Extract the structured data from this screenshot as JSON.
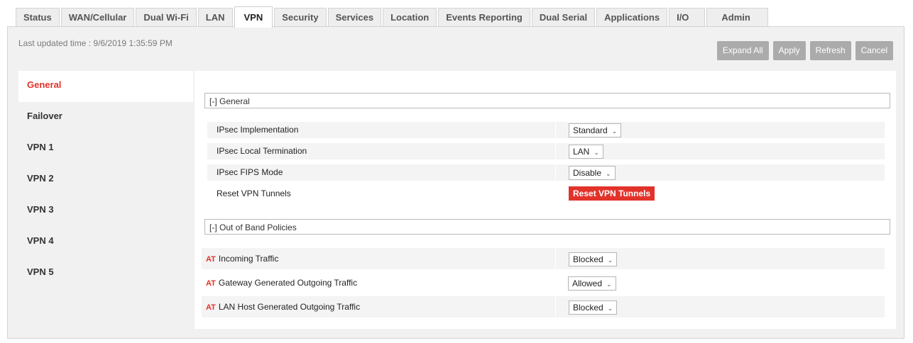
{
  "tabs": [
    {
      "label": "Status",
      "active": false
    },
    {
      "label": "WAN/Cellular",
      "active": false
    },
    {
      "label": "Dual Wi-Fi",
      "active": false
    },
    {
      "label": "LAN",
      "active": false
    },
    {
      "label": "VPN",
      "active": true
    },
    {
      "label": "Security",
      "active": false
    },
    {
      "label": "Services",
      "active": false
    },
    {
      "label": "Location",
      "active": false
    },
    {
      "label": "Events Reporting",
      "active": false
    },
    {
      "label": "Dual Serial",
      "active": false
    },
    {
      "label": "Applications",
      "active": false
    },
    {
      "label": "I/O",
      "active": false
    },
    {
      "label": "Admin",
      "active": false
    }
  ],
  "last_updated": "Last updated time : 9/6/2019 1:35:59 PM",
  "toolbar": {
    "expand_all": "Expand All",
    "apply": "Apply",
    "refresh": "Refresh",
    "cancel": "Cancel"
  },
  "sidebar": {
    "items": [
      {
        "label": "General",
        "active": true
      },
      {
        "label": "Failover",
        "active": false
      },
      {
        "label": "VPN 1",
        "active": false
      },
      {
        "label": "VPN 2",
        "active": false
      },
      {
        "label": "VPN 3",
        "active": false
      },
      {
        "label": "VPN 4",
        "active": false
      },
      {
        "label": "VPN 5",
        "active": false
      }
    ]
  },
  "general_section": {
    "header": "[-] General",
    "ipsec_impl": {
      "label": "IPsec Implementation",
      "value": "Standard"
    },
    "ipsec_local_term": {
      "label": "IPsec Local Termination",
      "value": "LAN"
    },
    "ipsec_fips": {
      "label": "IPsec FIPS Mode",
      "value": "Disable"
    },
    "reset_vpn": {
      "label": "Reset VPN Tunnels",
      "button": "Reset VPN Tunnels"
    }
  },
  "oob_section": {
    "header": "[-] Out of Band Policies",
    "at_marker": "AT",
    "incoming": {
      "label": "Incoming Traffic",
      "value": "Blocked"
    },
    "gateway_out": {
      "label": "Gateway Generated Outgoing Traffic",
      "value": "Allowed"
    },
    "lan_host_out": {
      "label": "LAN Host Generated Outgoing Traffic",
      "value": "Blocked"
    }
  },
  "colors": {
    "accent": "#e2322a",
    "button_gray": "#ababab",
    "row_bg": "#f4f4f4",
    "panel_bg": "#f1f1f1"
  }
}
